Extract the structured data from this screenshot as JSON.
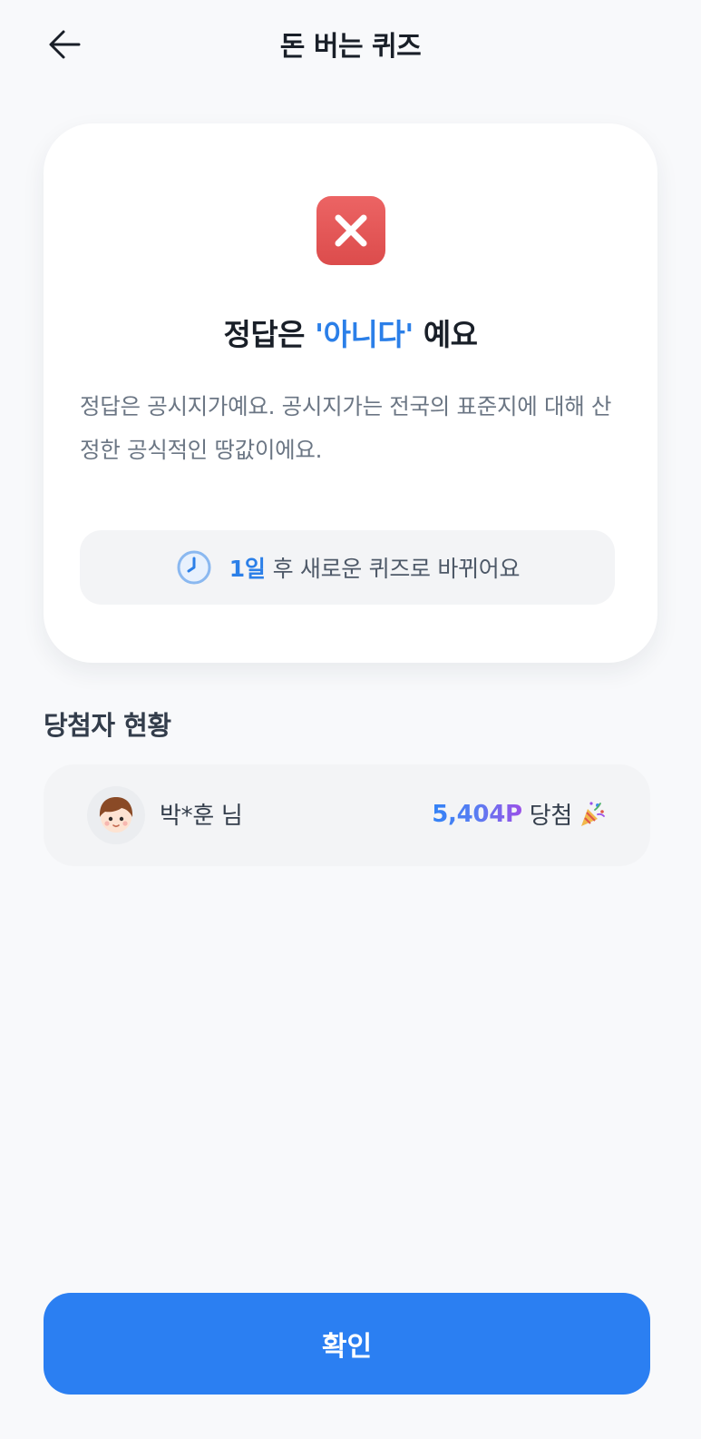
{
  "header": {
    "title": "돈 버는 퀴즈",
    "back_icon": "arrow-left-icon"
  },
  "result": {
    "icon": "x-mark-icon",
    "icon_color": "#e35656",
    "title_prefix": "정답은 ",
    "answer": "'아니다'",
    "title_suffix": " 예요",
    "explanation": "정답은 공시지가예요. 공시지가는 전국의 표준지에 대해 산정한 공식적인 땅값이에요.",
    "notice": {
      "icon": "clock-icon",
      "days": "1일",
      "text": "후 새로운 퀴즈로 바뀌어요"
    }
  },
  "winners": {
    "title": "당첨자 현황",
    "items": [
      {
        "avatar": "avatar-icon",
        "name": "박*훈 님",
        "points": "5,404P",
        "label": "당첨",
        "emoji": "party-popper-icon"
      }
    ]
  },
  "footer": {
    "confirm_label": "확인"
  },
  "colors": {
    "accent": "#2b7ff2",
    "answer": "#2b7fe8",
    "background": "#f8f9fb"
  }
}
